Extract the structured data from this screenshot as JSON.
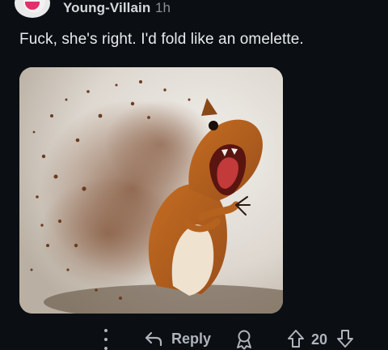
{
  "comment": {
    "username": "Young-Villain",
    "timestamp": "1h",
    "text": "Fuck, she's right. I'd fold like an omelette."
  },
  "actions": {
    "reply_label": "Reply",
    "vote_count": "20"
  },
  "icons": {
    "more": "more-vertical-icon",
    "reply": "reply-arrow-icon",
    "award": "award-icon",
    "upvote": "upvote-arrow-icon",
    "downvote": "downvote-arrow-icon"
  },
  "colors": {
    "background": "#0b0f13",
    "text": "#e8eaec",
    "muted": "#8a9096",
    "icon": "#aeb4ba"
  }
}
